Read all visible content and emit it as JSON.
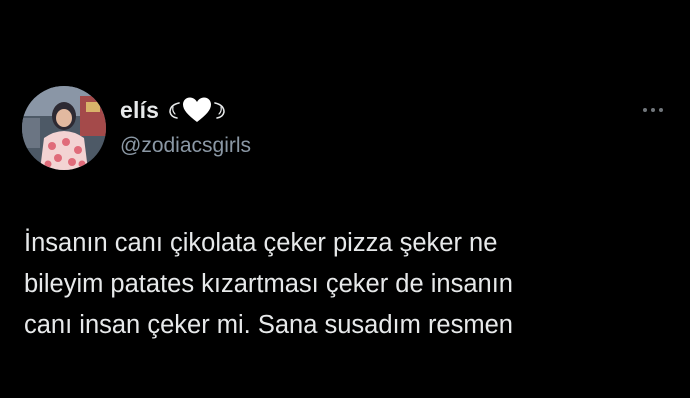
{
  "tweet": {
    "author": {
      "display_name": "elís",
      "handle": "@zodiacsgirls",
      "name_emojis": [
        "wing-left",
        "white-heart",
        "wing-right"
      ]
    },
    "text_lines": [
      "İnsanın canı çikolata çeker pizza şeker ne",
      "bileyim patates kızartması çeker de insanın",
      "canı insan çeker mi. Sana susadım resmen"
    ]
  },
  "colors": {
    "background": "#000000",
    "primary_text": "#e7e9ea",
    "secondary_text": "#8b98a5"
  },
  "icons": {
    "more": "more-horizontal-icon"
  }
}
